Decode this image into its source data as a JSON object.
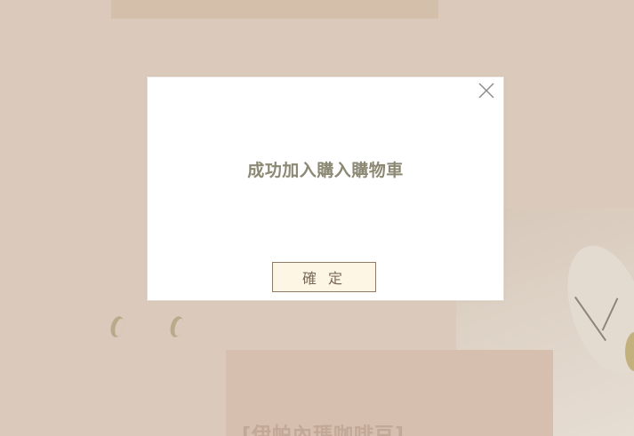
{
  "background": {
    "product_title": "[伊帕內瑪咖啡豆]"
  },
  "dialog": {
    "message": "成功加入購入購物車",
    "confirm_label": "確 定",
    "close_icon": "close-icon"
  },
  "colors": {
    "overlay_background": "#dbcabb",
    "dialog_background": "#ffffff",
    "message_text": "#8b8873",
    "confirm_button_background": "#fdf6e4",
    "confirm_button_border": "#8c7b67"
  }
}
